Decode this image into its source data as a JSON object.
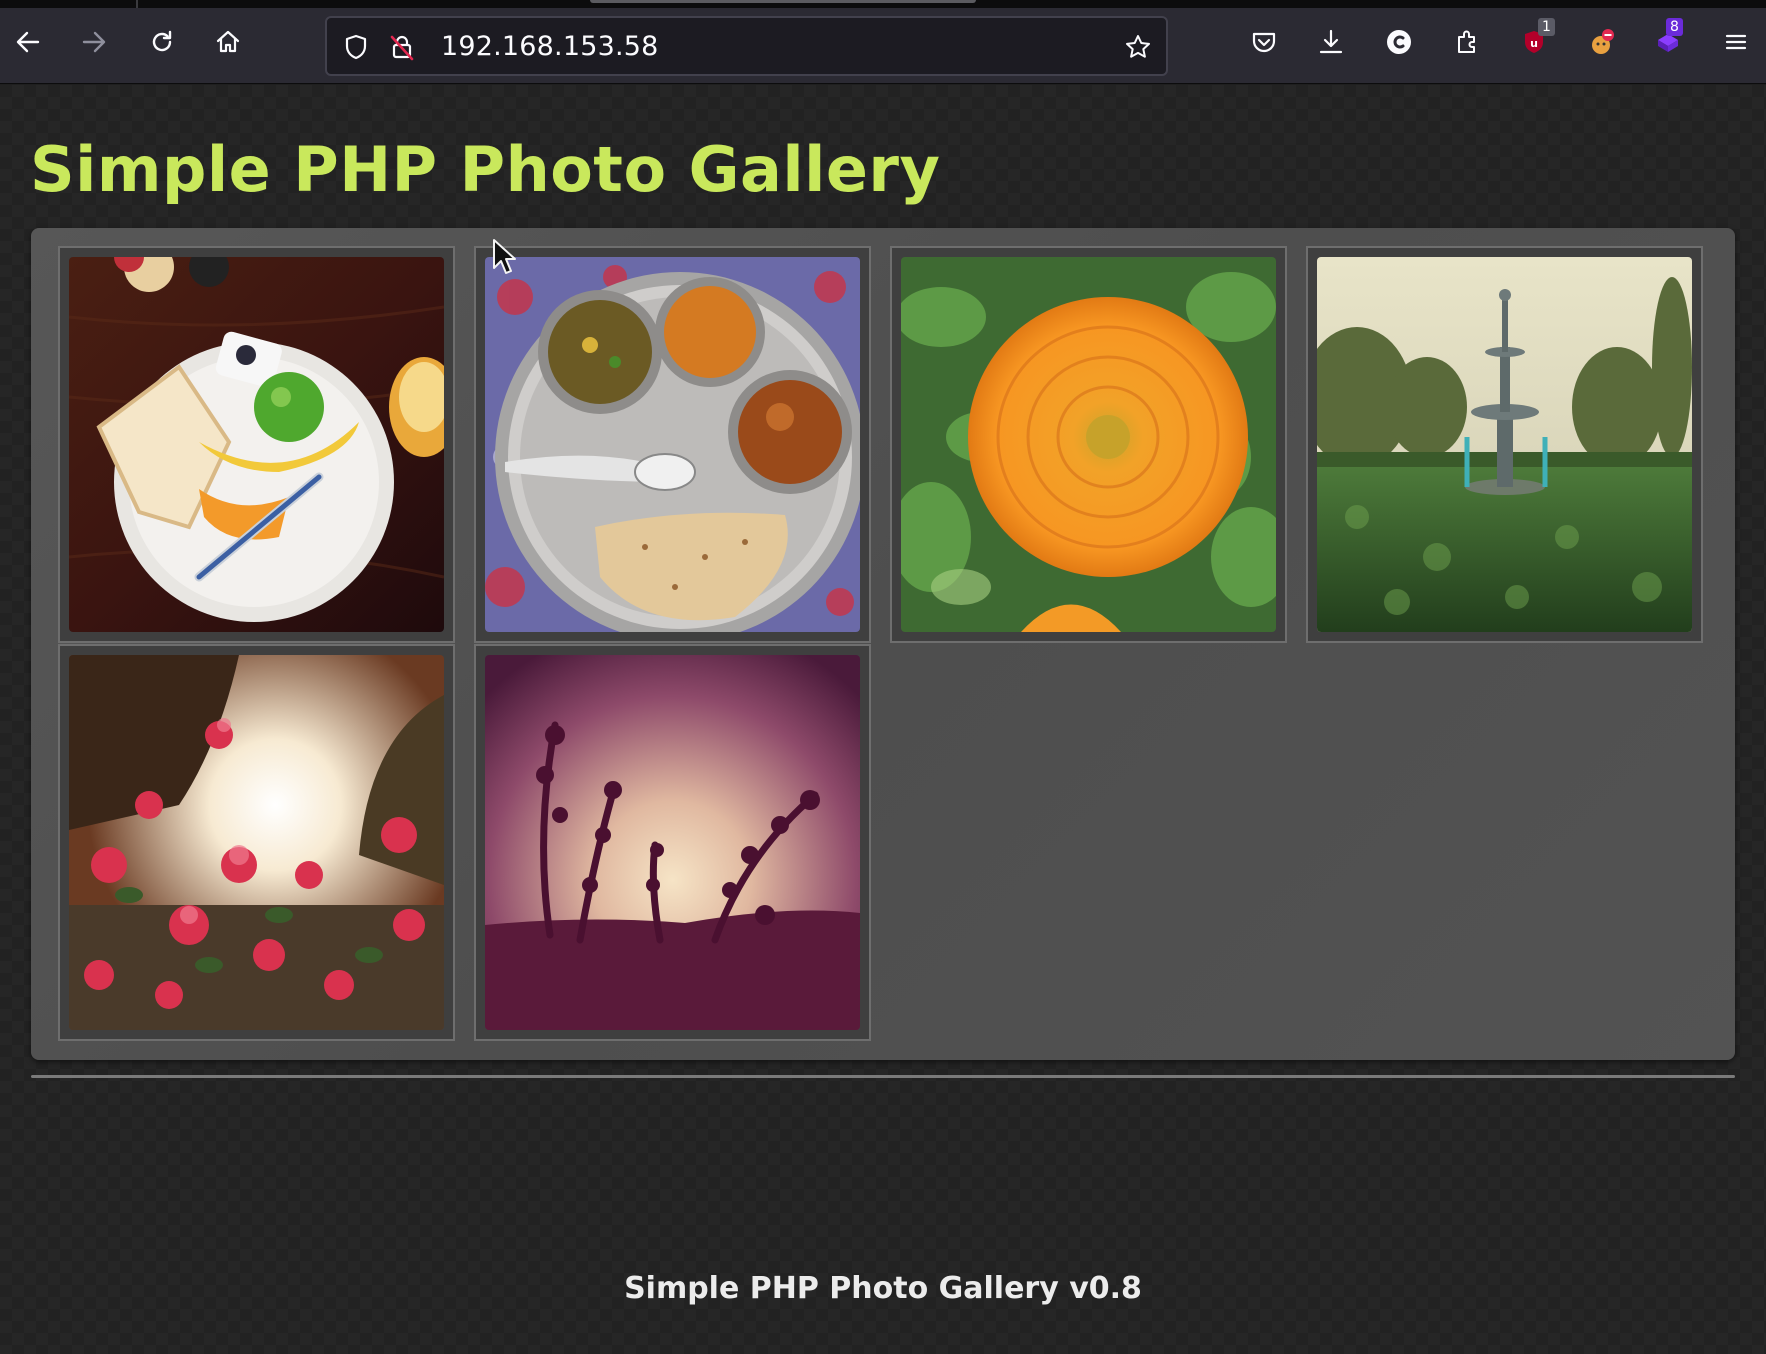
{
  "browser": {
    "url": "192.168.153.58",
    "toolbar": {
      "back_icon": "arrow-left-icon",
      "forward_icon": "arrow-right-icon",
      "reload_icon": "reload-icon",
      "home_icon": "home-icon",
      "bookmark_icon": "star-icon"
    },
    "extensions": {
      "ublock_count": "1",
      "purple_ext_count": "8"
    },
    "colors": {
      "toolbar_bg": "#2b2a33",
      "urlbar_bg": "#1c1b22",
      "ublock_red": "#b3002a",
      "purple_ext": "#6b2bd9"
    }
  },
  "page": {
    "title": "Simple PHP Photo Gallery",
    "footer": "Simple PHP Photo Gallery v0.8",
    "colors": {
      "title": "#c9e85c",
      "gallery_panel": "#525252",
      "footer_text": "#ececec"
    },
    "photos": [
      {
        "subject": "breakfast-plate"
      },
      {
        "subject": "thali-meal"
      },
      {
        "subject": "orange-flower"
      },
      {
        "subject": "garden-fountain"
      },
      {
        "subject": "bougainvillea-sunset"
      },
      {
        "subject": "plant-silhouette-sunset"
      }
    ]
  }
}
